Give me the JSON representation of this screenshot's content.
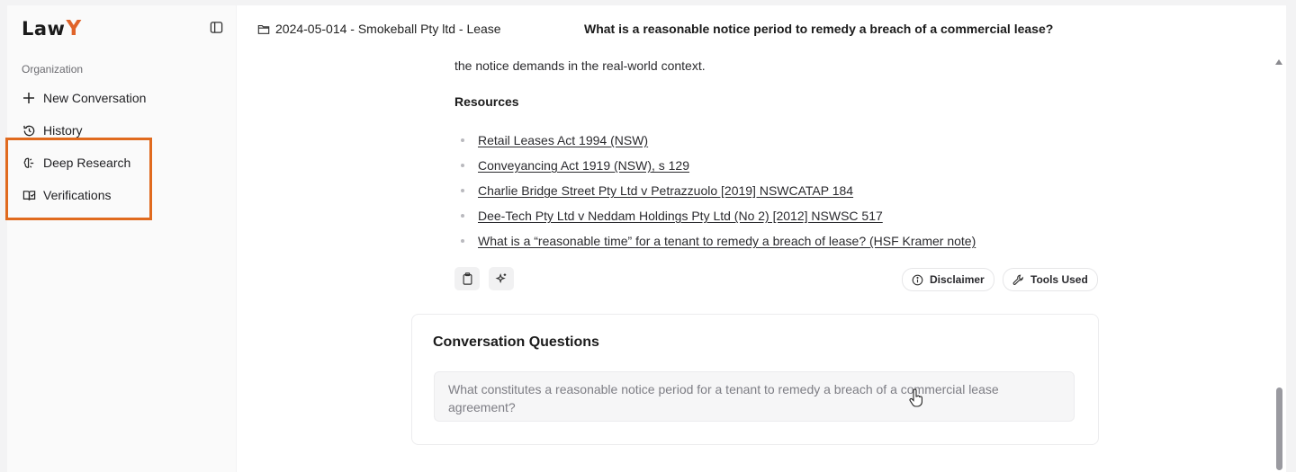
{
  "app": {
    "logo_text": "Law",
    "logo_accent": "Y"
  },
  "sidebar": {
    "section_label": "Organization",
    "items": [
      {
        "label": "New Conversation",
        "icon": "plus-icon"
      },
      {
        "label": "History",
        "icon": "history-icon"
      },
      {
        "label": "Deep Research",
        "icon": "brain-icon"
      },
      {
        "label": "Verifications",
        "icon": "book-check-icon"
      }
    ]
  },
  "header": {
    "matter": "2024-05-014 - Smokeball Pty ltd - Lease",
    "title": "What is a reasonable notice period to remedy a breach of a commercial lease?"
  },
  "answer": {
    "trailing_text": "the notice demands in the real-world context.",
    "resources_heading": "Resources",
    "resources": [
      "Retail Leases Act 1994 (NSW)",
      "Conveyancing Act 1919 (NSW), s 129",
      "Charlie Bridge Street Pty Ltd v Petrazzuolo [2019] NSWCATAP 184",
      "Dee-Tech Pty Ltd v Neddam Holdings Pty Ltd (No 2) [2012] NSWSC 517",
      "What is a “reasonable time” for a tenant to remedy a breach of lease? (HSF Kramer note)"
    ],
    "actions": {
      "disclaimer": "Disclaimer",
      "tools_used": "Tools Used"
    }
  },
  "questions_card": {
    "title": "Conversation Questions",
    "question": "What constitutes a reasonable notice period for a tenant to remedy a breach of a commercial lease agreement?"
  },
  "colors": {
    "accent": "#e0642a",
    "highlight": "#e06a1e"
  }
}
